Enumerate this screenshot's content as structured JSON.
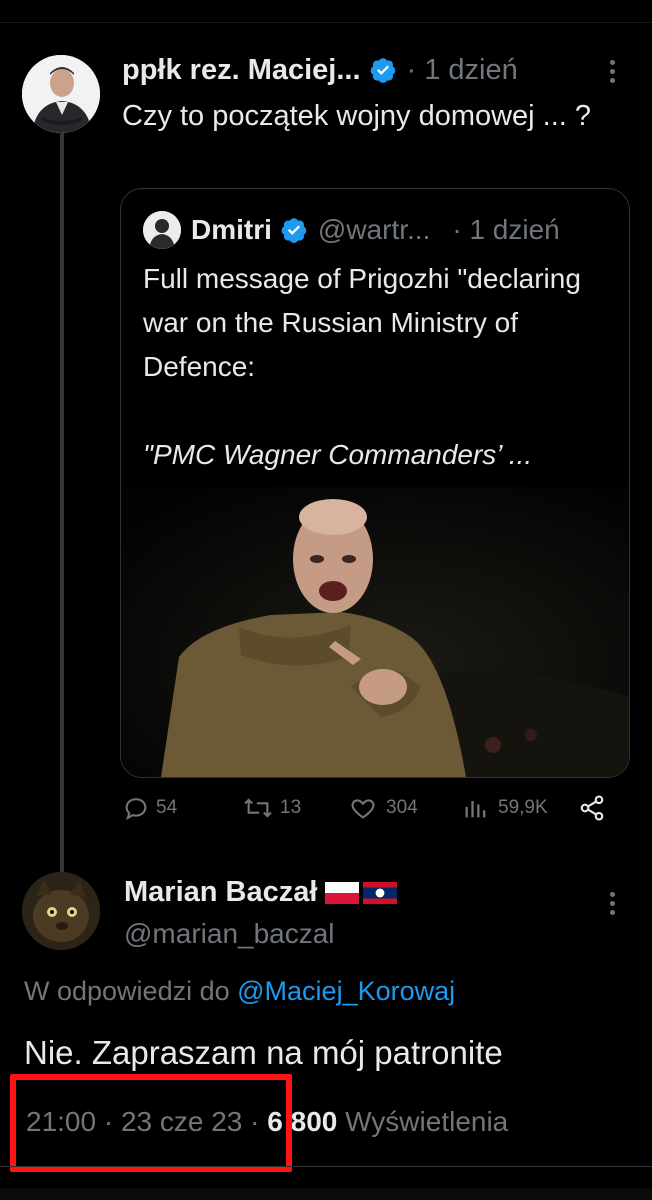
{
  "original_tweet": {
    "author_name": "ppłk rez. Maciej...",
    "time": "· 1 dzień",
    "text": "Czy to początek wojny domowej ... ?"
  },
  "quoted_tweet": {
    "author_name": "Dmitri",
    "handle": "@wartr...",
    "time": "· 1 dzień",
    "text": "Full message of Prigozhi \"declaring war on the Russian Ministry of Defence:",
    "quote_line": "\"PMC Wagner Commanders’ ..."
  },
  "actions": {
    "replies": "54",
    "retweets": "13",
    "likes": "304",
    "views": "59,9K"
  },
  "reply_tweet": {
    "author_name": "Marian Baczał",
    "handle": "@marian_baczal",
    "replying_prefix": "W odpowiedzi do",
    "replying_to": "@Maciej_Korowaj",
    "text": "Nie. Zapraszam na mój patronite",
    "time": "21:00 · 23 cze 23",
    "separator": "·",
    "views_count": "6 800",
    "views_label": "Wyświetlenia"
  },
  "colors": {
    "background": "#000000",
    "text": "#e7e9ea",
    "muted": "#71767b",
    "link": "#1d9bf0",
    "verified": "#1d9bf0",
    "highlight": "#ff1414"
  }
}
